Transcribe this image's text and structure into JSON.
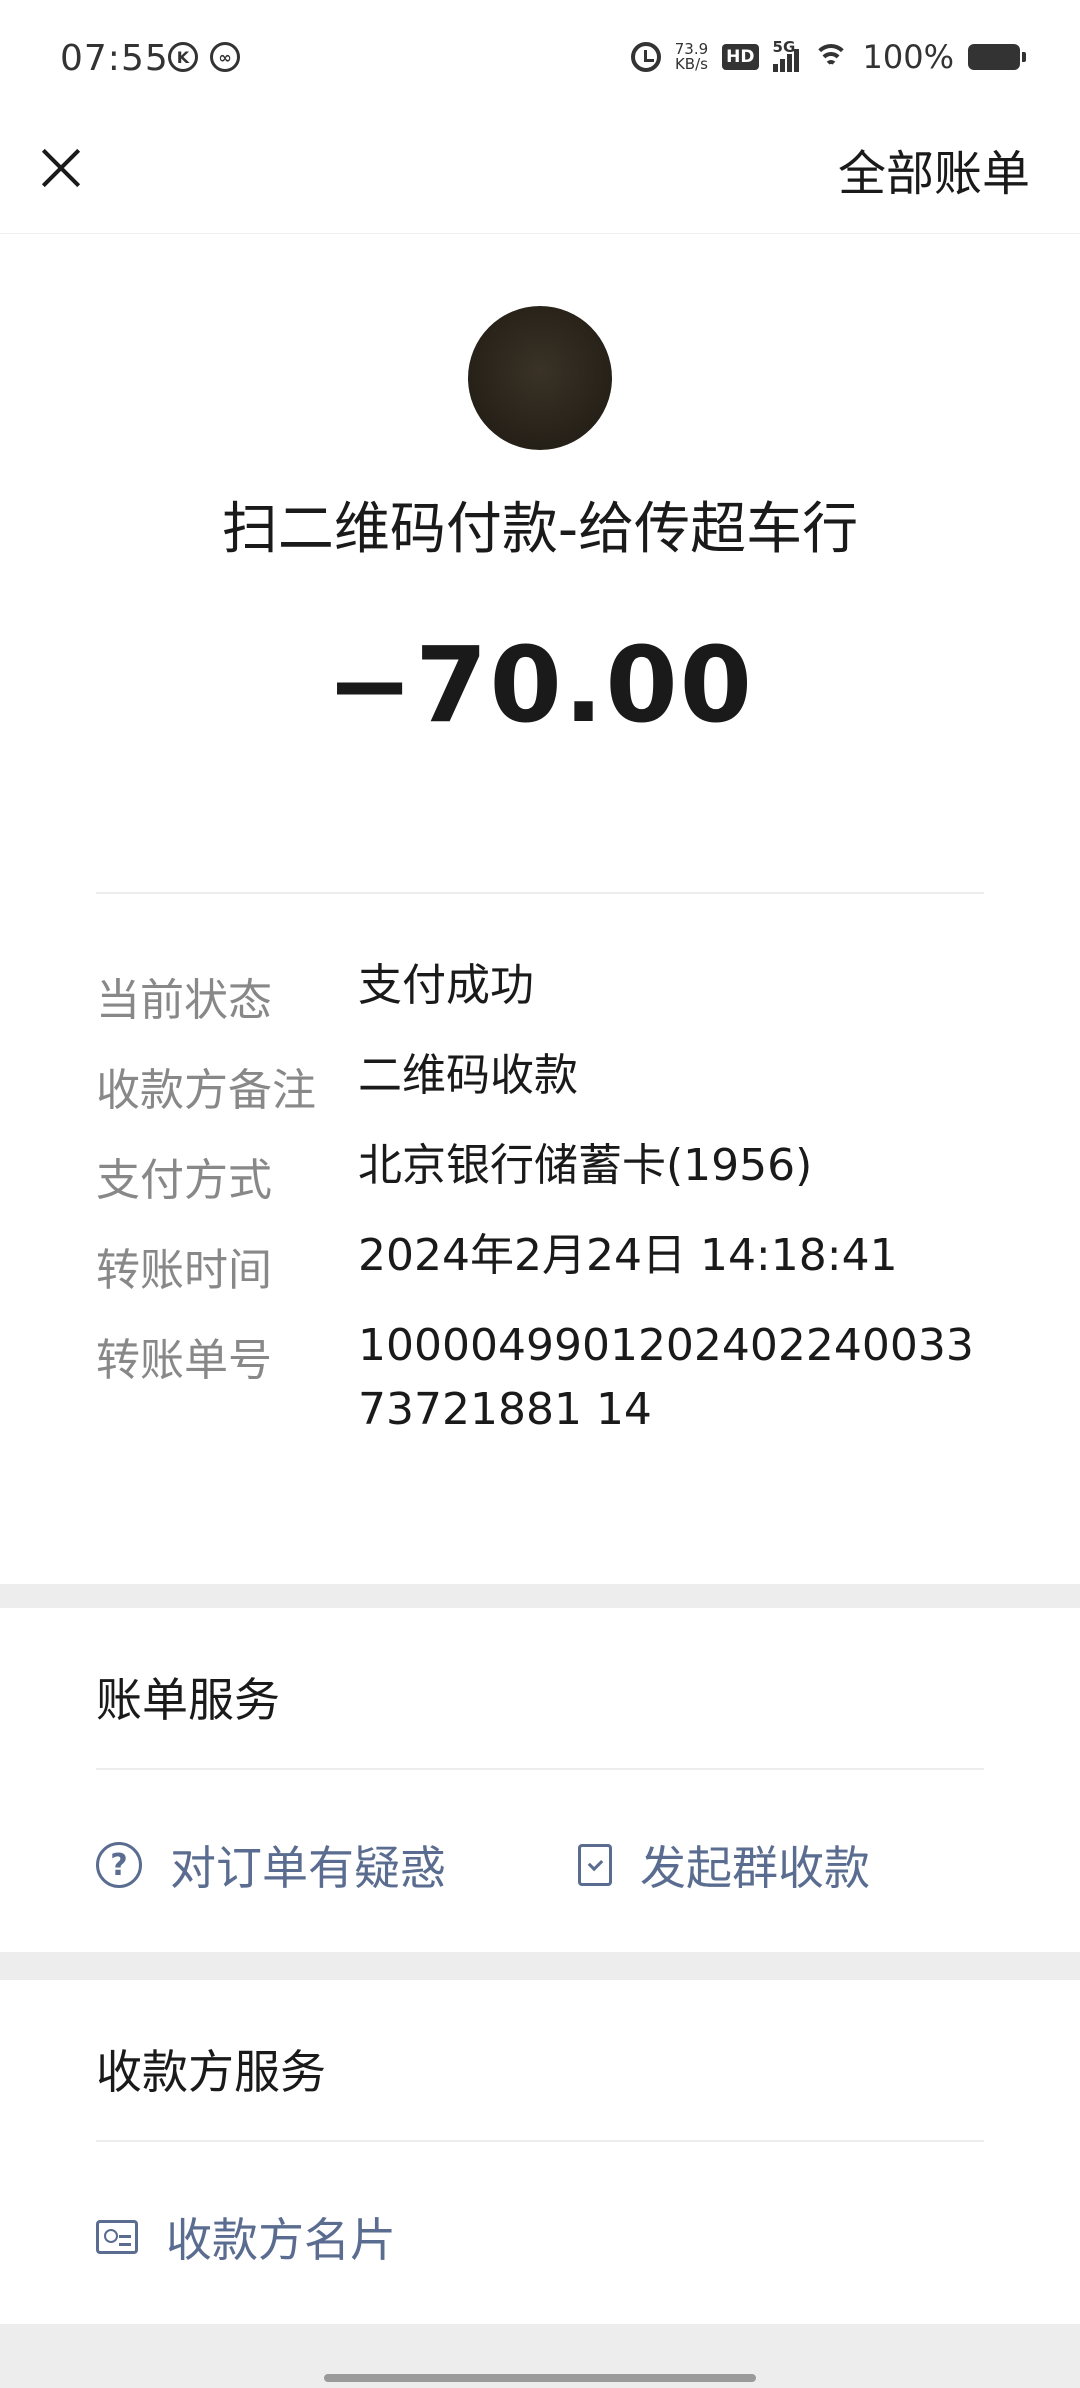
{
  "status_bar": {
    "time": "07:55",
    "network_speed": "73.9",
    "network_speed_unit": "KB/s",
    "hd": "HD",
    "signal": "5G",
    "battery": "100%"
  },
  "header": {
    "all_bills": "全部账单"
  },
  "transaction": {
    "title": "扫二维码付款-给传超车行",
    "amount": "−70.00"
  },
  "details": [
    {
      "label": "当前状态",
      "value": "支付成功"
    },
    {
      "label": "收款方备注",
      "value": "二维码收款"
    },
    {
      "label": "支付方式",
      "value": "北京银行储蓄卡(1956)"
    },
    {
      "label": "转账时间",
      "value": "2024年2月24日 14:18:41"
    },
    {
      "label": "转账单号",
      "value": "100004990120240224003373721881 14"
    }
  ],
  "bill_service": {
    "title": "账单服务",
    "dispute": "对订单有疑惑",
    "group_collect": "发起群收款"
  },
  "payee_service": {
    "title": "收款方服务",
    "business_card": "收款方名片"
  },
  "icons": {
    "close": "close-icon",
    "question": "question-circle-icon",
    "group_collect": "document-check-icon",
    "business_card": "id-card-icon"
  }
}
